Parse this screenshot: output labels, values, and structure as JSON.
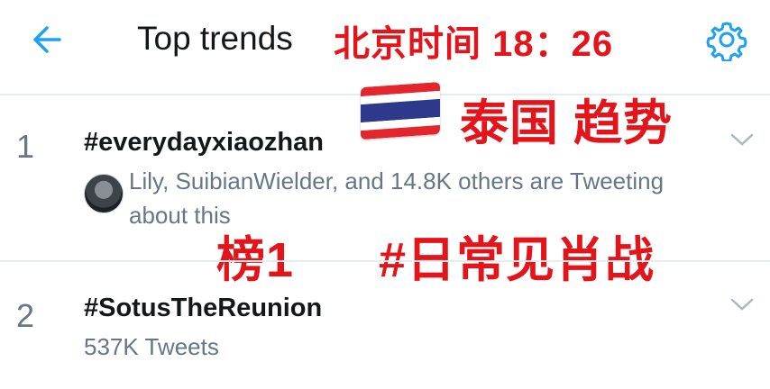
{
  "header": {
    "title": "Top trends",
    "overlay_time": "北京时间 18：26"
  },
  "overlay": {
    "country": "泰国 趋势",
    "rank_label": "榜1",
    "translated_tag": "#日常见肖战"
  },
  "trends": [
    {
      "rank": "1",
      "hashtag": "#everydayxiaozhan",
      "context": "Lily, SuibianWielder, and 14.8K others are Tweeting",
      "context_cont": "about this"
    },
    {
      "rank": "2",
      "hashtag": "#SotusTheReunion",
      "count": "537K Tweets"
    }
  ],
  "icons": {
    "back": "arrow-left-icon",
    "settings": "gear-icon",
    "expand": "chevron-down-icon",
    "flag": "thailand-flag"
  },
  "colors": {
    "accent": "#1da1f2",
    "overlay_red": "#e4141b",
    "secondary_text": "#657786"
  }
}
